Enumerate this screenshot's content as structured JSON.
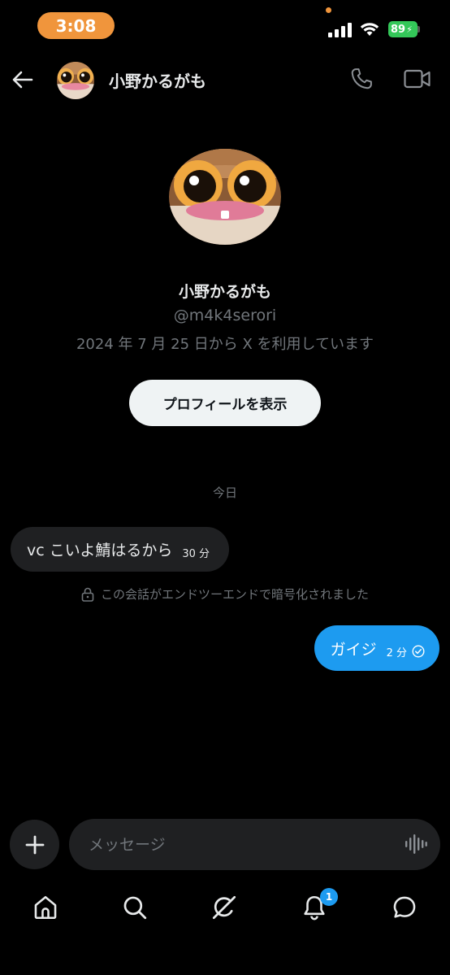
{
  "status_bar": {
    "time": "3:08",
    "battery": "89"
  },
  "header": {
    "name": "小野かるがも"
  },
  "profile": {
    "name": "小野かるがも",
    "handle": "@m4k4serori",
    "joined": "2024 年 7 月 25 日から X を利用しています",
    "button_label": "プロフィールを表示"
  },
  "conversation": {
    "date_divider": "今日",
    "encryption_note": "この会話がエンドツーエンドで暗号化されました",
    "messages": [
      {
        "direction": "incoming",
        "text": "vc こいよ鯖はるから",
        "time": "30 分"
      },
      {
        "direction": "outgoing",
        "text": "ガイジ",
        "time": "2 分"
      }
    ]
  },
  "composer": {
    "placeholder": "メッセージ"
  },
  "bottom_nav": {
    "items": [
      "home-icon",
      "search-icon",
      "grok-icon",
      "bell-icon",
      "messages-icon"
    ],
    "notification_badge": "1"
  },
  "colors": {
    "accent": "#1d9bf0",
    "time_pill": "#f0953c",
    "battery": "#34c759"
  }
}
